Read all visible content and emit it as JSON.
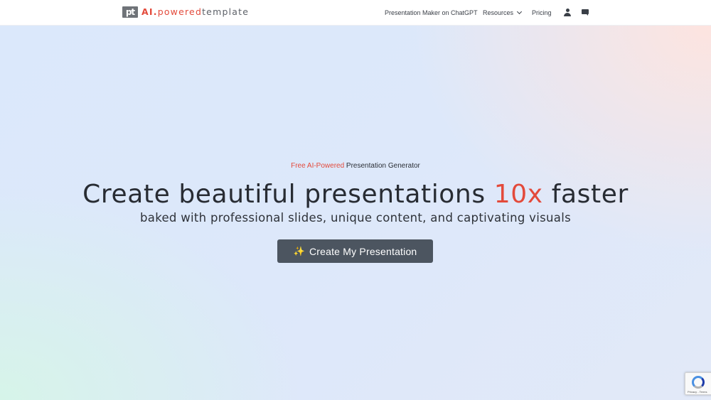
{
  "header": {
    "logo": {
      "mark": "pt",
      "ai": "AI.",
      "powered": "powered",
      "template": "template"
    },
    "nav": {
      "chatgpt_label": "Presentation Maker on ChatGPT",
      "resources_label": "Resources",
      "pricing_label": "Pricing"
    },
    "icons": [
      "user-icon",
      "chat-icon"
    ]
  },
  "hero": {
    "tagline_accent": "Free AI-Powered",
    "tagline_rest": " Presentation Generator",
    "headline_start": "Create beautiful presentations ",
    "headline_accent": "10x",
    "headline_end": " faster",
    "subhead": "baked with professional slides, unique content, and captivating visuals",
    "cta_icon": "✨",
    "cta_label": "Create My Presentation"
  },
  "recaptcha": {
    "text": "Privacy - Terms"
  },
  "colors": {
    "accent": "#e34a3b",
    "cta_bg": "#4c5560",
    "text": "#282c33"
  }
}
